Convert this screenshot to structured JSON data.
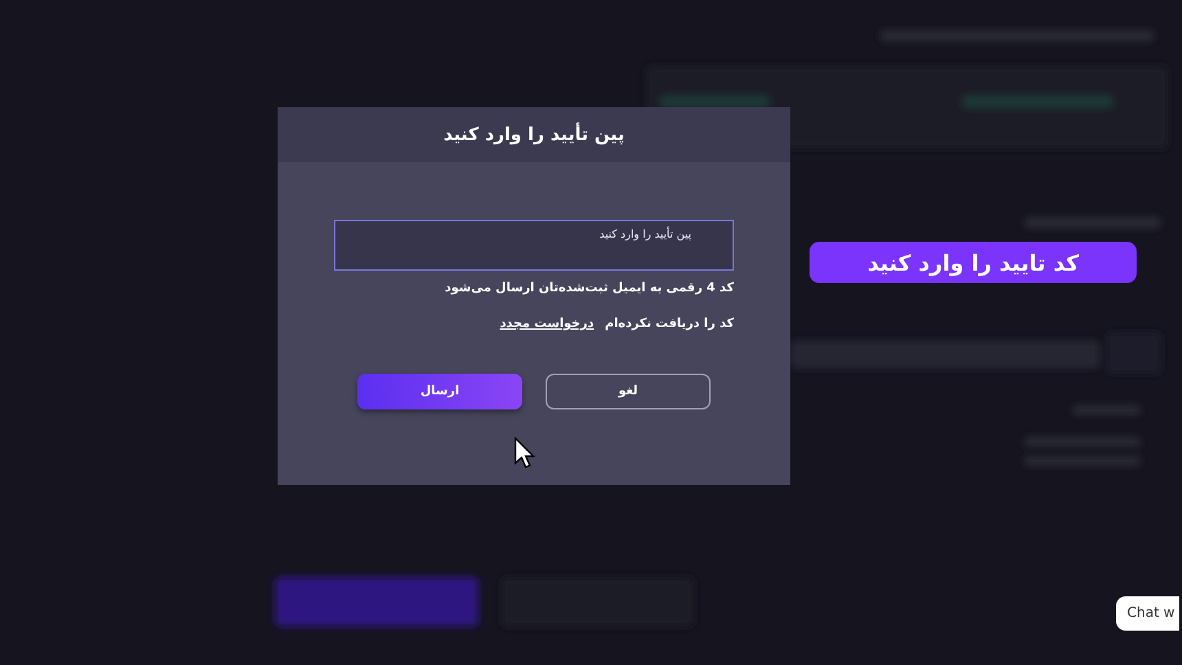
{
  "dialog": {
    "title": "پین تأیید را وارد کنید",
    "pin_field": {
      "placeholder": "پین تأیید را وارد کنید"
    },
    "hint": "کد 4 رقمی به ایمیل ثبت‌شده‌تان ارسال می‌شود",
    "resend": {
      "text": "کد را دریافت نکرده‌ام",
      "link": "درخواست مجدد"
    },
    "buttons": [
      {
        "label": "لغو",
        "kind": "secondary"
      },
      {
        "label": "ارسال",
        "kind": "primary"
      }
    ]
  },
  "callout": {
    "text": "کد تایید را وارد کنید"
  },
  "chat_button": {
    "label": "Chat w"
  }
}
